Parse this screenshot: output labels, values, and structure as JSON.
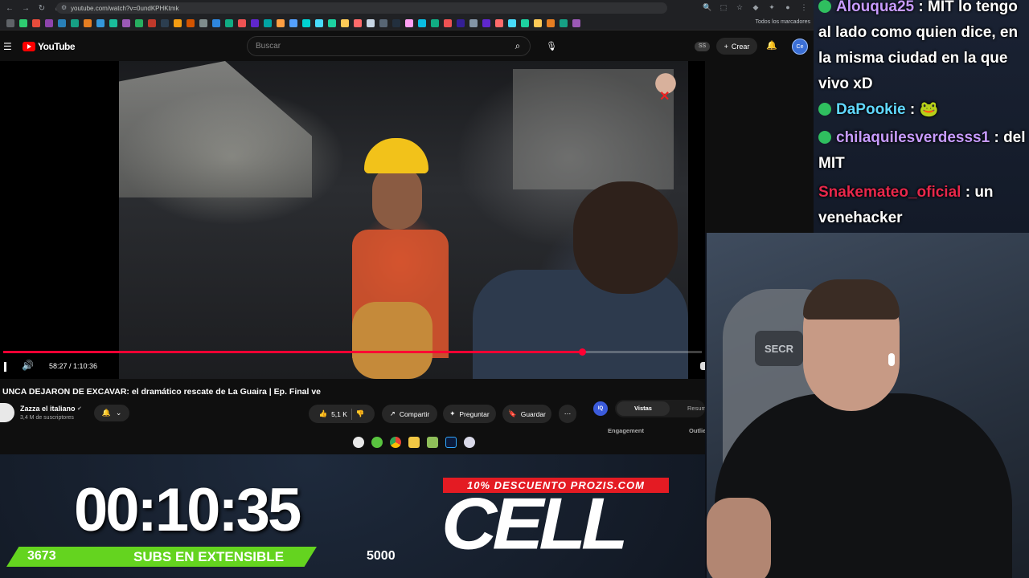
{
  "browser": {
    "url": "youtube.com/watch?v=0undKPHKtmk",
    "bookmarks_all": "Todos los marcadores",
    "bookmark_colors": [
      "#5f6368",
      "#2ecc71",
      "#e74c3c",
      "#8e44ad",
      "#2980b9",
      "#16a085",
      "#e67e22",
      "#3498db",
      "#1abc9c",
      "#9b59b6",
      "#27ae60",
      "#c0392b",
      "#2c3e50",
      "#f39c12",
      "#d35400",
      "#7f8c8d",
      "#2e86de",
      "#10ac84",
      "#ee5253",
      "#5f27cd",
      "#01a3a4",
      "#ff9f43",
      "#54a0ff",
      "#00d2d3",
      "#48dbfb",
      "#1dd1a1",
      "#feca57",
      "#ff6b6b",
      "#c8d6e5",
      "#576574",
      "#222f3e",
      "#ff9ff3",
      "#0abde3",
      "#10ac84",
      "#ee5253",
      "#341f97",
      "#8395a7",
      "#5f27cd",
      "#ff6b6b",
      "#48dbfb",
      "#1dd1a1",
      "#feca57",
      "#e67e22",
      "#16a085",
      "#9b59b6"
    ]
  },
  "youtube": {
    "logo_text": "YouTube",
    "search_placeholder": "Buscar",
    "ss_badge": "SS",
    "create_label": "Crear",
    "avatar_text": "Ce"
  },
  "video": {
    "current_time": "58:27",
    "duration": "1:10:36",
    "time_display": "58:27 / 1:10:36",
    "progress_fraction": 0.828,
    "title": "UNCA DEJARON DE EXCAVAR: el dramático rescate de La Guaira | Ep. Final ve",
    "channel_name": "Zazza el italiano",
    "subscribers": "3,4 M de suscriptores",
    "likes": "5,1 K",
    "share_label": "Compartir",
    "ask_label": "Preguntar",
    "save_label": "Guardar"
  },
  "side_panel": {
    "iq_label": "IQ",
    "tab_views": "Vistas",
    "tab_summary": "Resum",
    "engagement_label": "Engagement",
    "outlier_label": "Outlie"
  },
  "chat": {
    "messages": [
      {
        "user": "Alouqua25",
        "text": "MIT lo tengo al lado como quien dice, en la misma ciudad en la que vivo xD",
        "color": "#c79bff"
      },
      {
        "user": "DaPookie",
        "text": "🐸",
        "color": "#60d8ff"
      },
      {
        "user": "chilaquilesverdesss1",
        "text": "del MIT",
        "color": "#c79bff"
      },
      {
        "user": "Snakemateo_oficial",
        "text": "un venehacker",
        "color": "#e8274b"
      }
    ]
  },
  "webcam": {
    "chair_brand": "SECR"
  },
  "overlay": {
    "timer": "00:10:35",
    "goal_current": "3673",
    "goal_label": "SUBS EN EXTENSIBLE",
    "goal_target": "5000",
    "promo_text": "10% DESCUENTO PROZIS.COM",
    "sponsor_logo": "CELL",
    "accent_green": "#64d41f",
    "accent_red": "#e41b23"
  }
}
